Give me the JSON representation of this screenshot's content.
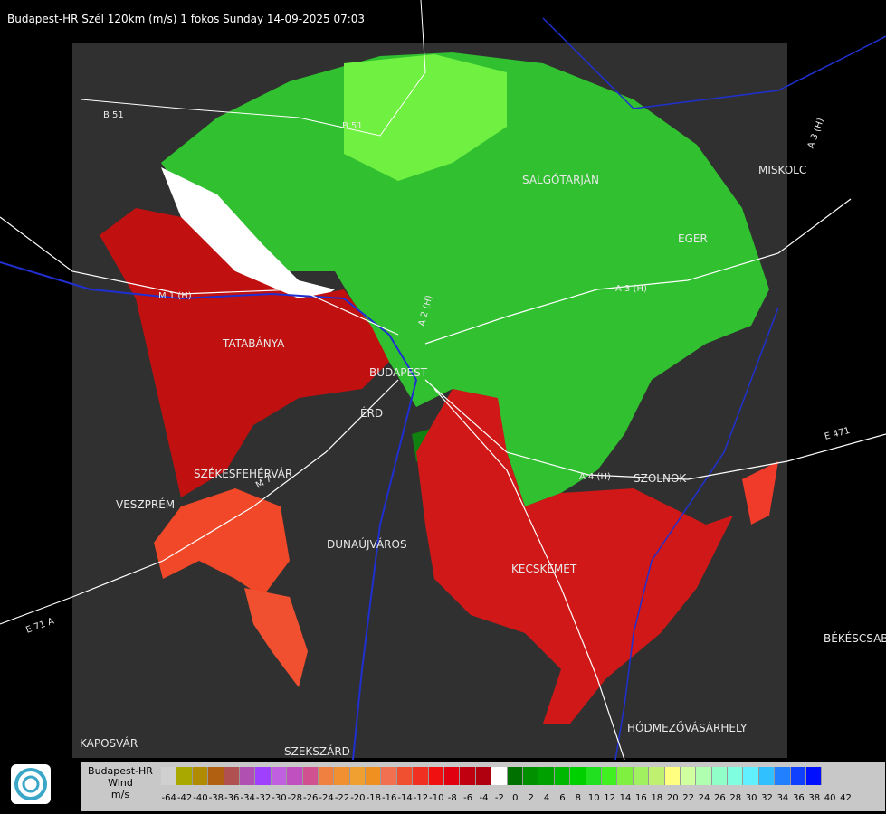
{
  "header": {
    "title": "Budapest-HR Szél 120km (m/s) 1 fokos Sunday 14-09-2025 07:03"
  },
  "cities": [
    {
      "name": "SALGÓTARJÁN"
    },
    {
      "name": "MISKOLC"
    },
    {
      "name": "EGER"
    },
    {
      "name": "TATABÁNYA"
    },
    {
      "name": "BUDAPEST"
    },
    {
      "name": "ÉRD"
    },
    {
      "name": "SZÉKESFEHÉRVÁR"
    },
    {
      "name": "VESZPRÉM"
    },
    {
      "name": "DUNAÚJVÁROS"
    },
    {
      "name": "KECSKEMÉT"
    },
    {
      "name": "SZOLNOK"
    },
    {
      "name": "BÉKÉSCSABA"
    },
    {
      "name": "HÓDMEZŐVÁSÁRHELY"
    },
    {
      "name": "KAPOSVÁR"
    },
    {
      "name": "SZEKSZÁRD"
    }
  ],
  "roads": [
    "B 51",
    "B 51",
    "M 1 (H)",
    "A 3 (H)",
    "A 3 (H)",
    "A 2 (H)",
    "A 4 (H)",
    "E 471",
    "E 71 A",
    "M 7"
  ],
  "legend": {
    "label_line1": "Budapest-HR",
    "label_line2": "Wind",
    "label_line3": "m/s",
    "swatch_colors": [
      "#d0d0d0",
      "#a8a800",
      "#b08a00",
      "#b06010",
      "#b05050",
      "#b050b0",
      "#a040ff",
      "#c060e0",
      "#c050c0",
      "#d05090",
      "#f08040",
      "#f09030",
      "#f0a030",
      "#f09020",
      "#f07050",
      "#f05030",
      "#f03020",
      "#f01010",
      "#e00010",
      "#c00010",
      "#b00010",
      "#ffffff",
      "#007000",
      "#009000",
      "#00a000",
      "#00b800",
      "#00d000",
      "#20e020",
      "#40f020",
      "#80f040",
      "#a0f060",
      "#c0f070",
      "#ffff80",
      "#d0ffa0",
      "#b0ffb0",
      "#90ffc8",
      "#80ffe0",
      "#60f0ff",
      "#30c0ff",
      "#2080ff",
      "#1040ff",
      "#0010ff"
    ],
    "ticks": [
      "-64",
      "-42",
      "-40",
      "-38",
      "-36",
      "-34",
      "-32",
      "-30",
      "-28",
      "-26",
      "-24",
      "-22",
      "-20",
      "-18",
      "-16",
      "-14",
      "-12",
      "-10",
      "-8",
      "-6",
      "-4",
      "-2",
      "0",
      "2",
      "4",
      "6",
      "8",
      "10",
      "12",
      "14",
      "16",
      "18",
      "20",
      "22",
      "24",
      "26",
      "28",
      "30",
      "32",
      "34",
      "36",
      "38",
      "40",
      "42"
    ]
  }
}
